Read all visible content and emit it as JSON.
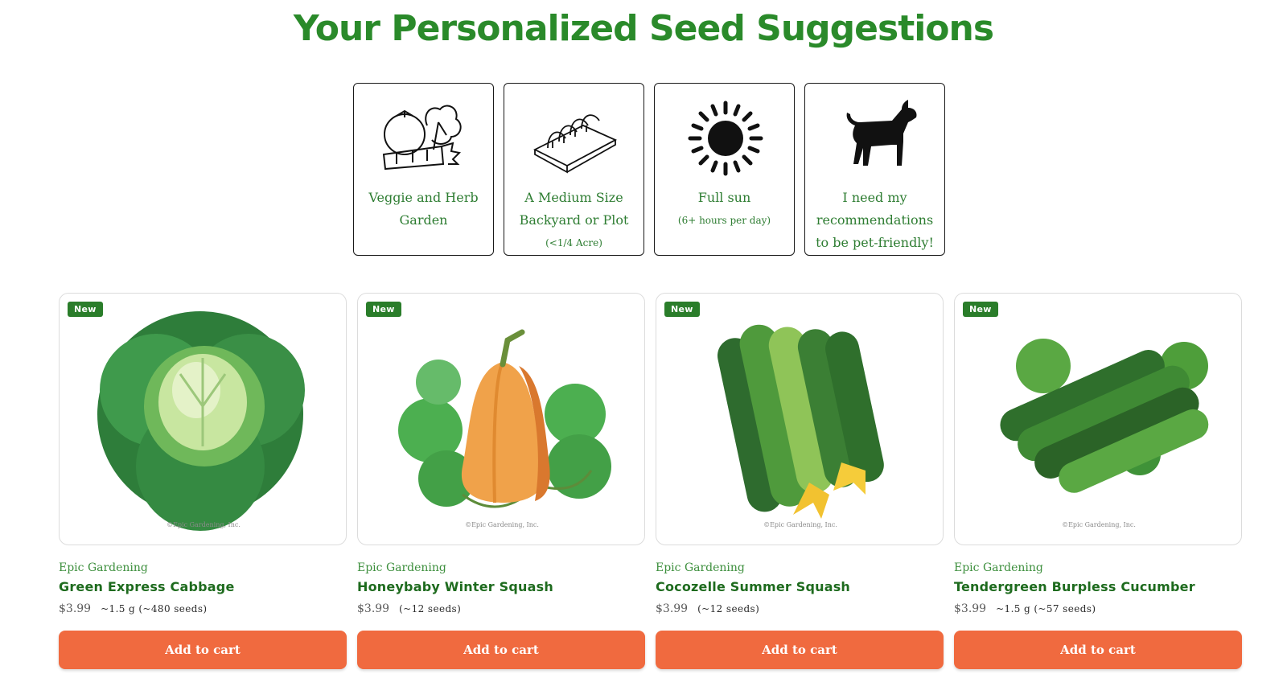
{
  "page": {
    "title": "Your Personalized Seed Suggestions"
  },
  "preferences": [
    {
      "icon": "veggie-herb-icon",
      "label": "Veggie and Herb Garden",
      "sub": ""
    },
    {
      "icon": "garden-bed-icon",
      "label": "A Medium Size Backyard or Plot",
      "sub": "(<1/4 Acre)"
    },
    {
      "icon": "sun-icon",
      "label": "Full sun",
      "sub": "(6+ hours per day)"
    },
    {
      "icon": "dog-icon",
      "label": "I need my recommendations to be pet-friendly!",
      "sub": ""
    }
  ],
  "products": [
    {
      "badge": "New",
      "image_icon": "cabbage-image",
      "copyright": "©Epic Gardening, Inc.",
      "vendor": "Epic Gardening",
      "name": "Green Express Cabbage",
      "price": "$3.99",
      "quantity": "~1.5 g (~480 seeds)",
      "button": "Add to cart"
    },
    {
      "badge": "New",
      "image_icon": "winter-squash-image",
      "copyright": "©Epic Gardening, Inc.",
      "vendor": "Epic Gardening",
      "name": "Honeybaby Winter Squash",
      "price": "$3.99",
      "quantity": "(~12 seeds)",
      "button": "Add to cart"
    },
    {
      "badge": "New",
      "image_icon": "summer-squash-image",
      "copyright": "©Epic Gardening, Inc.",
      "vendor": "Epic Gardening",
      "name": "Cocozelle Summer Squash",
      "price": "$3.99",
      "quantity": "(~12 seeds)",
      "button": "Add to cart"
    },
    {
      "badge": "New",
      "image_icon": "cucumber-image",
      "copyright": "©Epic Gardening, Inc.",
      "vendor": "Epic Gardening",
      "name": "Tendergreen Burpless Cucumber",
      "price": "$3.99",
      "quantity": "~1.5 g (~57 seeds)",
      "button": "Add to cart"
    }
  ],
  "colors": {
    "title": "#2a8a2a",
    "accent_button": "#f06a3f",
    "badge": "#2a7d2a",
    "product_name": "#1e6b1e",
    "vendor": "#3d8f3d"
  }
}
